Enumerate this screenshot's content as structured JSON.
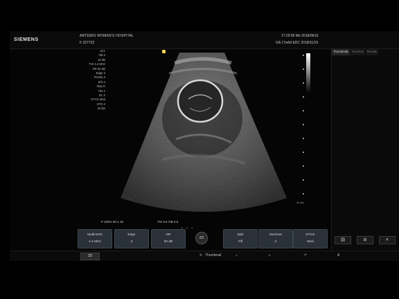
{
  "header": {
    "brand": "SIEMENS",
    "hospital": "ARTEMIS WOMEN'S HOSPITAL",
    "patient": "F   227722",
    "clock": "17:25:56  Mo  2018/06/11",
    "ga_edc": "GA 17w0d   EDC 2018/11/19"
  },
  "params": [
    "4C1",
    "OB-3",
    "15 dB",
    "THI 4.4 MHz",
    "DR 60 dB",
    "Edge 3",
    "Persist 3",
    "B/S 2",
    "Map D",
    "Tint 2",
    "SC 2",
    "DTCE Med",
    "DTO 2",
    "25 fps"
  ],
  "image": {
    "depth_label": "11 cm",
    "p_mi": "P 100%   MI 1.19",
    "tis_tib": "TIS 0.6   TIB 0.6"
  },
  "side": {
    "tabs": [
      "Thumbnails",
      "Favorites",
      "Results"
    ],
    "buttons": [
      "🖨",
      "⊞",
      "✕"
    ]
  },
  "controls": [
    {
      "title": "MultiHertz",
      "value": "4.4 MHz"
    },
    {
      "title": "Edge",
      "value": "3"
    },
    {
      "title": "DR",
      "value": "60 dB"
    },
    {
      "title": "Split",
      "value": "Off"
    },
    {
      "title": "SieClear",
      "value": "2"
    },
    {
      "title": "DTCE",
      "value": "Med"
    }
  ],
  "dial_label": "2D",
  "footer": {
    "mode": "2D",
    "thumbnail": "Thumbnail",
    "icons": [
      "↻",
      "☼",
      "◑",
      "↶",
      "A"
    ]
  }
}
